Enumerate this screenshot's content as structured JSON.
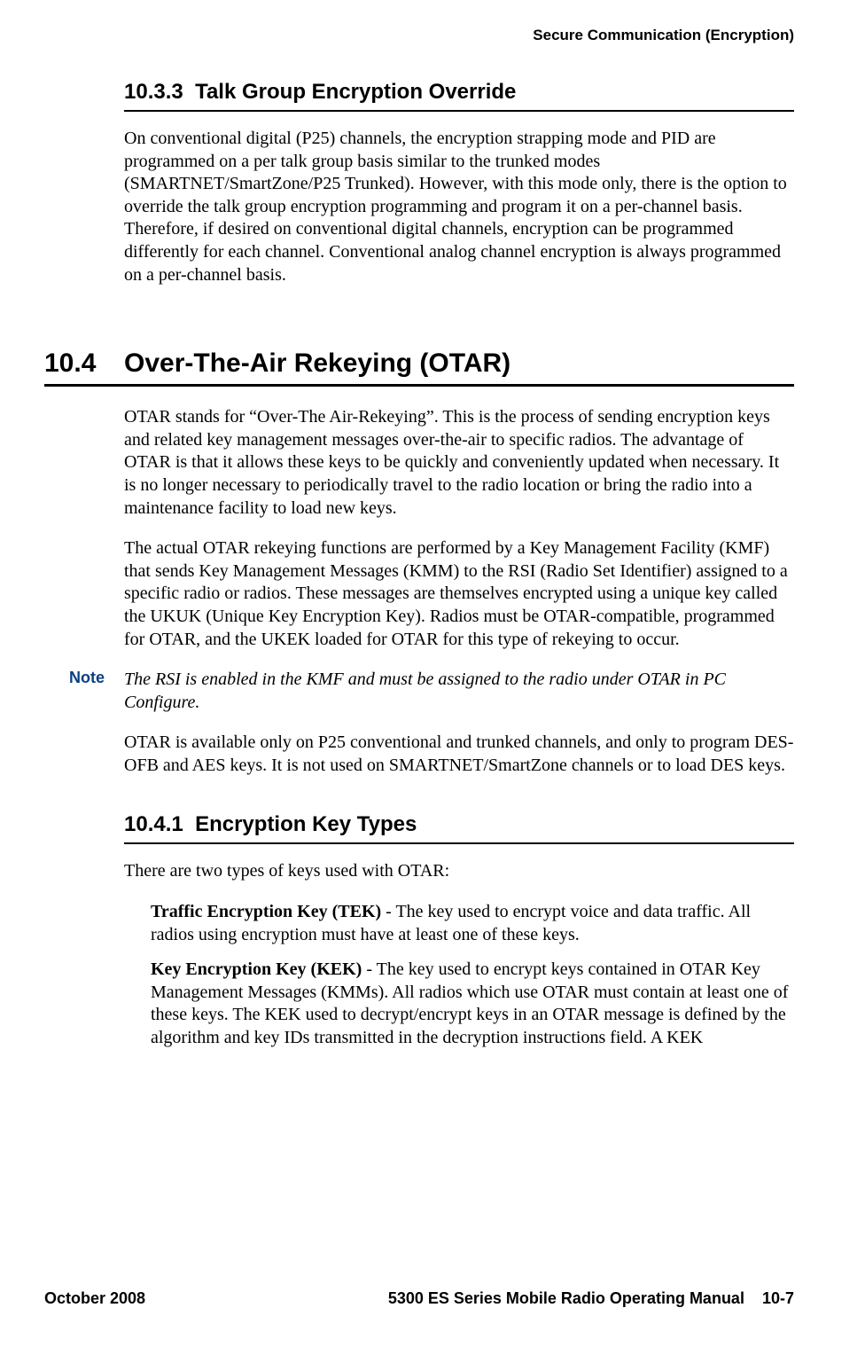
{
  "header": {
    "right": "Secure Communication (Encryption)"
  },
  "section_10_3_3": {
    "number": "10.3.3",
    "title": "Talk Group Encryption Override",
    "para1": "On conventional digital (P25) channels, the encryption strapping mode and PID are programmed on a per talk group basis similar to the trunked modes (SMARTNET/SmartZone/P25 Trunked). However, with this mode only, there is the option to override the talk group encryption programming and program it on a per-channel basis. Therefore, if desired on conventional digital channels, encryption can be programmed differently for each channel. Conventional analog channel encryption is always programmed on a per-channel basis."
  },
  "section_10_4": {
    "number": "10.4",
    "title": "Over-The-Air Rekeying (OTAR)",
    "para1": "OTAR stands for “Over-The Air-Rekeying”. This is the process of sending encryption keys and related key management messages over-the-air to specific radios. The advantage of OTAR is that it allows these keys to be quickly and conveniently updated when necessary. It is no longer necessary to periodically travel to the radio location or bring the radio into a maintenance facility to load new keys.",
    "para2": "The actual OTAR rekeying functions are performed by a Key Management Facility (KMF) that sends Key Management Messages (KMM) to the RSI (Radio Set Identifier) assigned to a specific radio or radios. These messages are themselves encrypted using a unique key called the UKUK (Unique Key Encryption Key). Radios must be OTAR-compatible, programmed for OTAR, and the UKEK loaded for OTAR for this type of rekeying to occur.",
    "note_label": "Note",
    "note_text": "The RSI is enabled in the KMF and must be assigned to the radio under OTAR in PC Configure.",
    "para3": "OTAR is available only on P25 conventional and trunked channels, and only to program DES-OFB and AES keys. It is not used on SMARTNET/SmartZone channels or to load DES keys."
  },
  "section_10_4_1": {
    "number": "10.4.1",
    "title": "Encryption Key Types",
    "para1": "There are two types of keys used with OTAR:",
    "tek_label": "Traffic Encryption Key (TEK)",
    "tek_text": " - The key used to encrypt voice and data traffic. All radios using encryption must have at least one of these keys.",
    "kek_label": "Key Encryption Key (KEK)",
    "kek_text": " - The key used to encrypt keys contained in OTAR Key Management Messages (KMMs). All radios which use OTAR must contain at least one of these keys. The KEK used to decrypt/encrypt keys in an OTAR message is defined by the algorithm and key IDs transmitted in the decryption instructions field. A KEK"
  },
  "footer": {
    "left": "October 2008",
    "center": "5300 ES Series Mobile Radio Operating Manual",
    "right": "10-7"
  }
}
